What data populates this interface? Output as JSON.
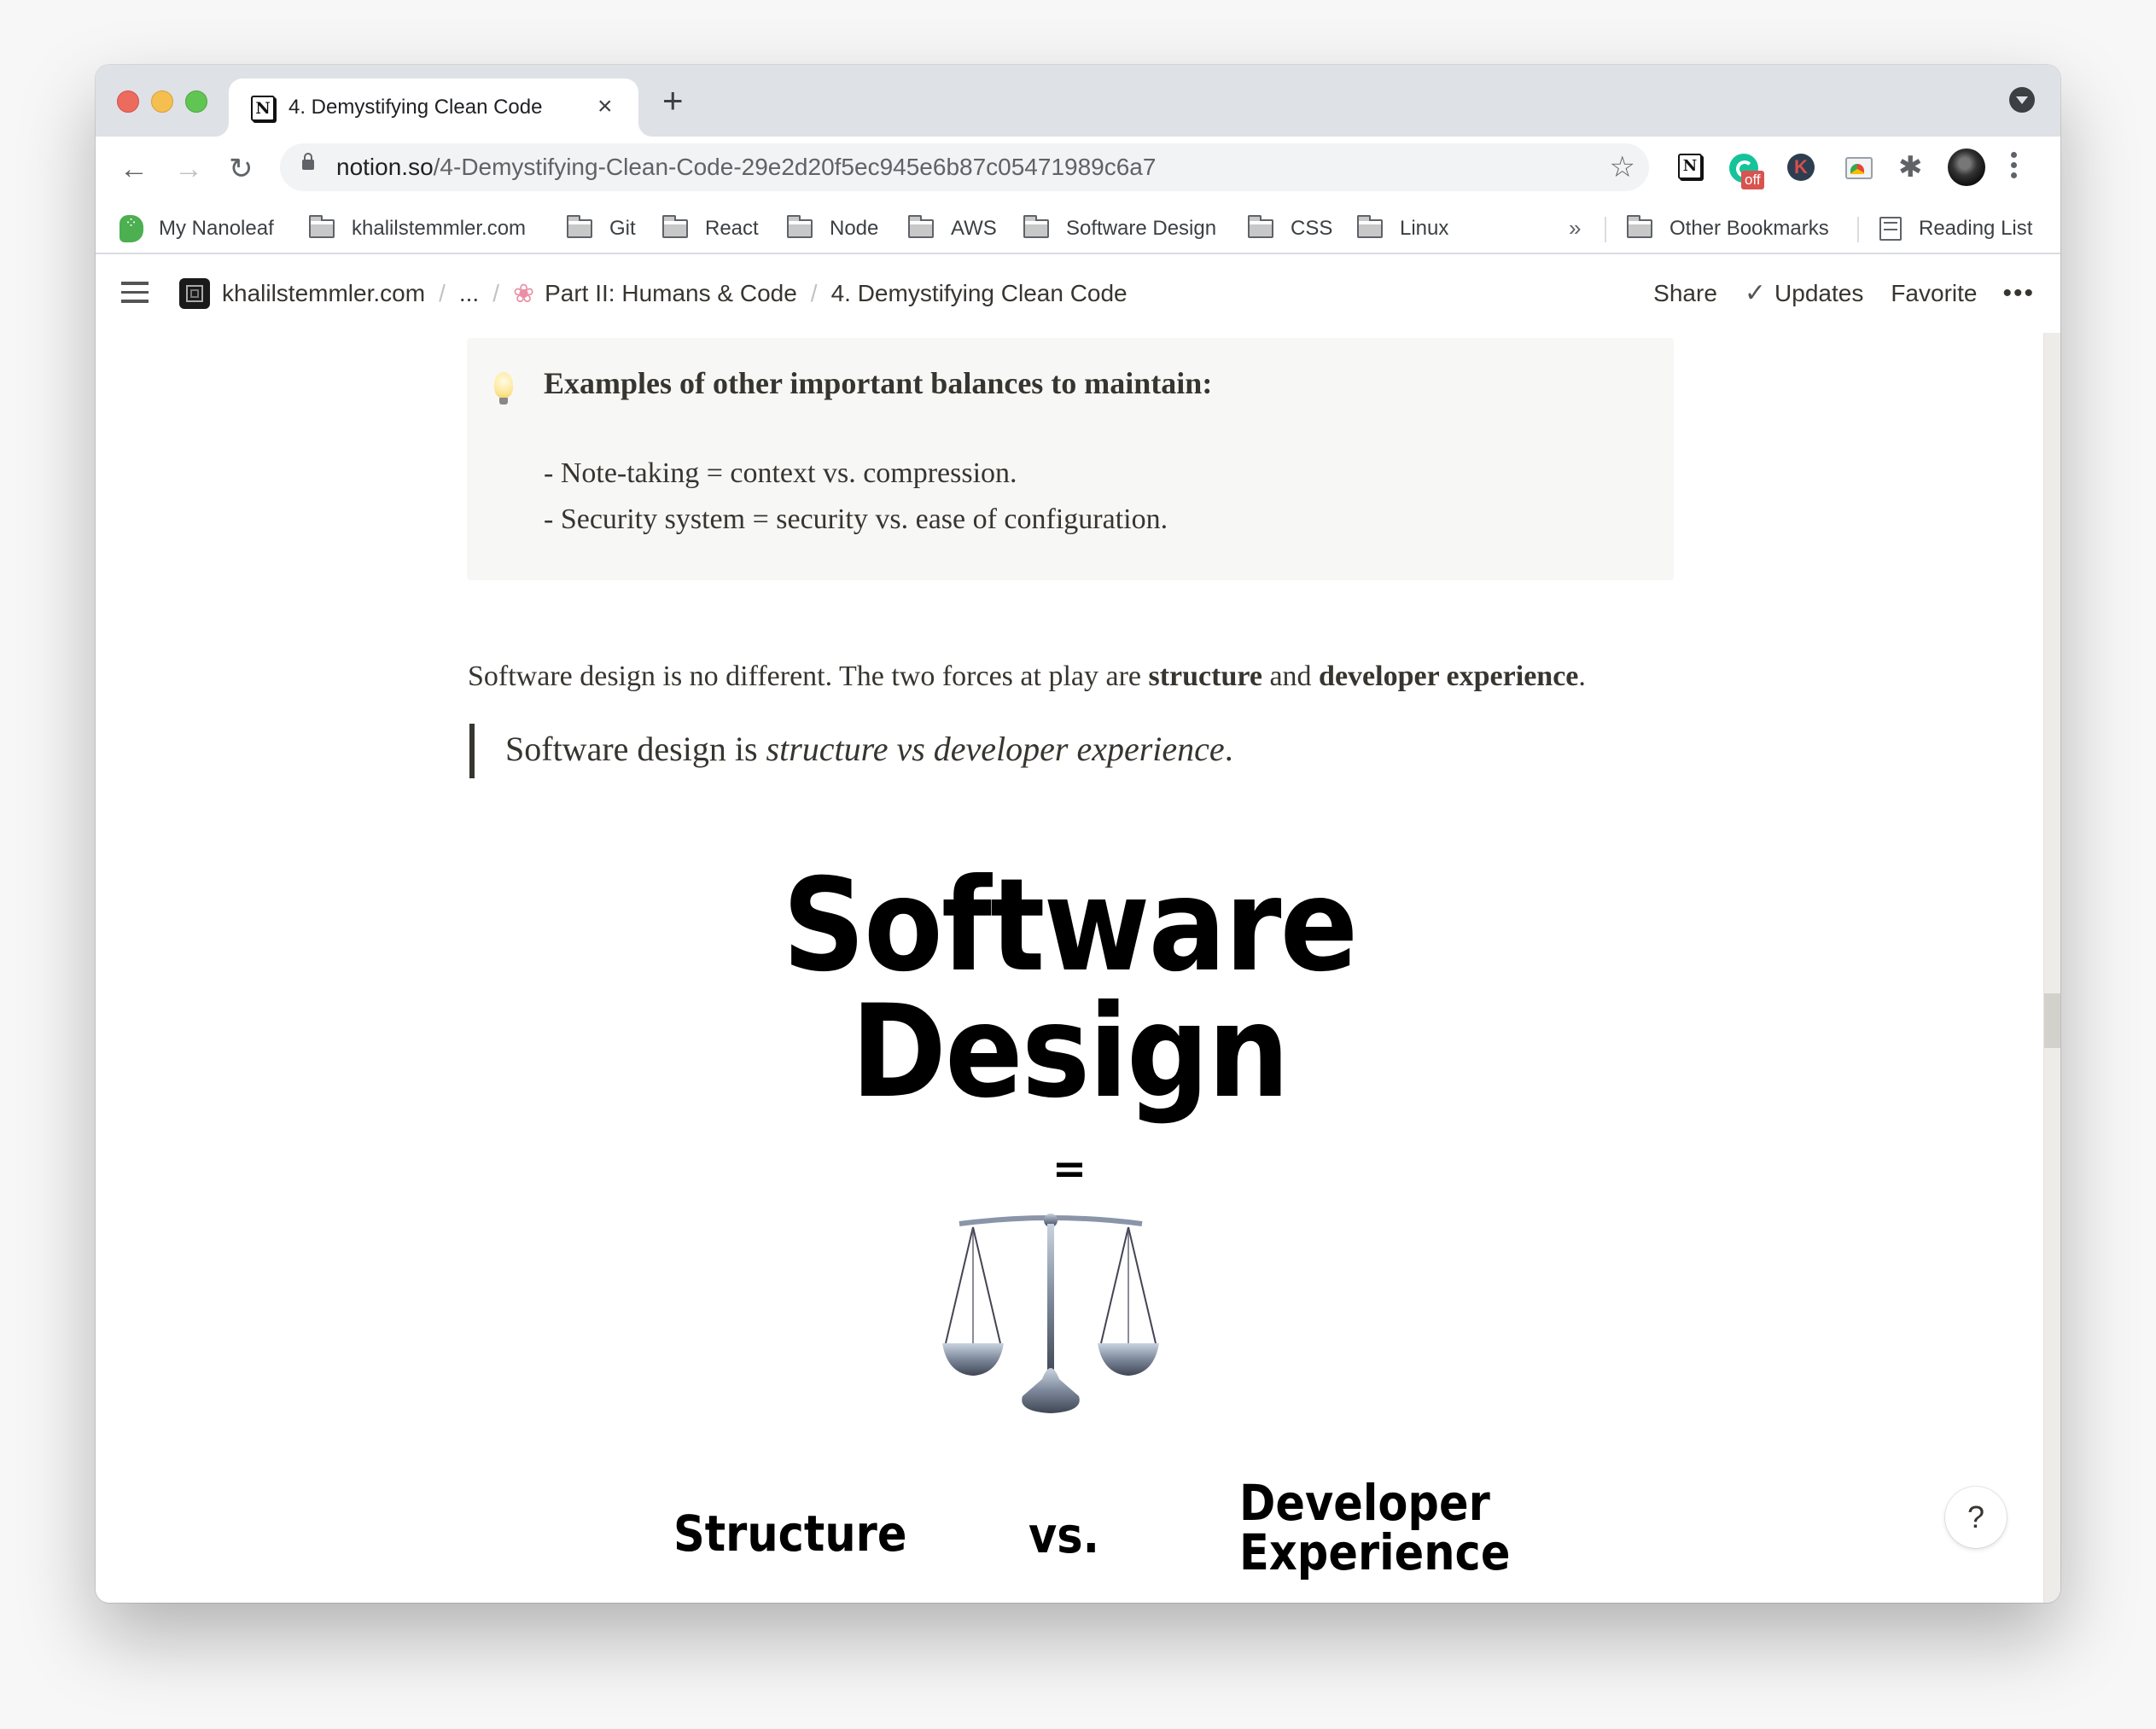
{
  "browser": {
    "tab": {
      "title": "4. Demystifying Clean Code",
      "favicon": "notion-icon",
      "close": "×"
    },
    "new_tab": "+",
    "nav": {
      "back": "←",
      "forward": "→",
      "reload": "↻"
    },
    "url": {
      "host": "notion.so",
      "path": "/4-Demystifying-Clean-Code-29e2d20f5ec945e6b87c05471989c6a7"
    },
    "extensions": [
      "notion-icon",
      "grammarly-icon",
      "k-extension-icon",
      "cast-icon",
      "puzzle-icon",
      "profile-avatar"
    ],
    "extension_badge": "off",
    "extension_k_letter": "K",
    "bookmarks": [
      {
        "label": "My Nanoleaf",
        "icon": "nanoleaf-icon"
      },
      {
        "label": "khalilstemmler.com",
        "icon": "folder-icon"
      },
      {
        "label": "Git",
        "icon": "folder-icon"
      },
      {
        "label": "React",
        "icon": "folder-icon"
      },
      {
        "label": "Node",
        "icon": "folder-icon"
      },
      {
        "label": "AWS",
        "icon": "folder-icon"
      },
      {
        "label": "Software Design",
        "icon": "folder-icon"
      },
      {
        "label": "CSS",
        "icon": "folder-icon"
      },
      {
        "label": "Linux",
        "icon": "folder-icon"
      }
    ],
    "bookmarks_overflow": "»",
    "other_bookmarks": "Other Bookmarks",
    "reading_list": "Reading List"
  },
  "notion": {
    "breadcrumb": [
      {
        "label": "khalilstemmler.com",
        "icon": "workspace-icon"
      },
      {
        "label": "..."
      },
      {
        "label": "Part II: Humans & Code",
        "icon": "brain-icon"
      },
      {
        "label": "4. Demystifying Clean Code"
      }
    ],
    "breadcrumb_separator": "/",
    "actions": {
      "share": "Share",
      "updates": "Updates",
      "favorite": "Favorite",
      "more": "•••"
    },
    "callout": {
      "icon": "lightbulb-icon",
      "title": "Examples of other important balances to maintain:",
      "lines": [
        "- Note-taking = context vs. compression.",
        "- Security system = security vs. ease of configuration."
      ]
    },
    "paragraph": {
      "pre": "Software design is no different. The two forces at play are ",
      "bold1": "structure",
      "mid": " and ",
      "bold2": "developer experience",
      "post": "."
    },
    "quote": {
      "pre": "Software design is ",
      "italic": "structure vs developer experience",
      "post": "."
    },
    "image": {
      "title_line1": "Software",
      "title_line2": "Design",
      "equals": "=",
      "icon": "balance-scale-icon",
      "left": "Structure",
      "vs": "vs.",
      "right_line1": "Developer",
      "right_line2": "Experience"
    },
    "help": "?"
  },
  "colors": {
    "text": "#37352f",
    "callout_bg": "#f7f7f6",
    "tabstrip_bg": "#dee1e6"
  }
}
